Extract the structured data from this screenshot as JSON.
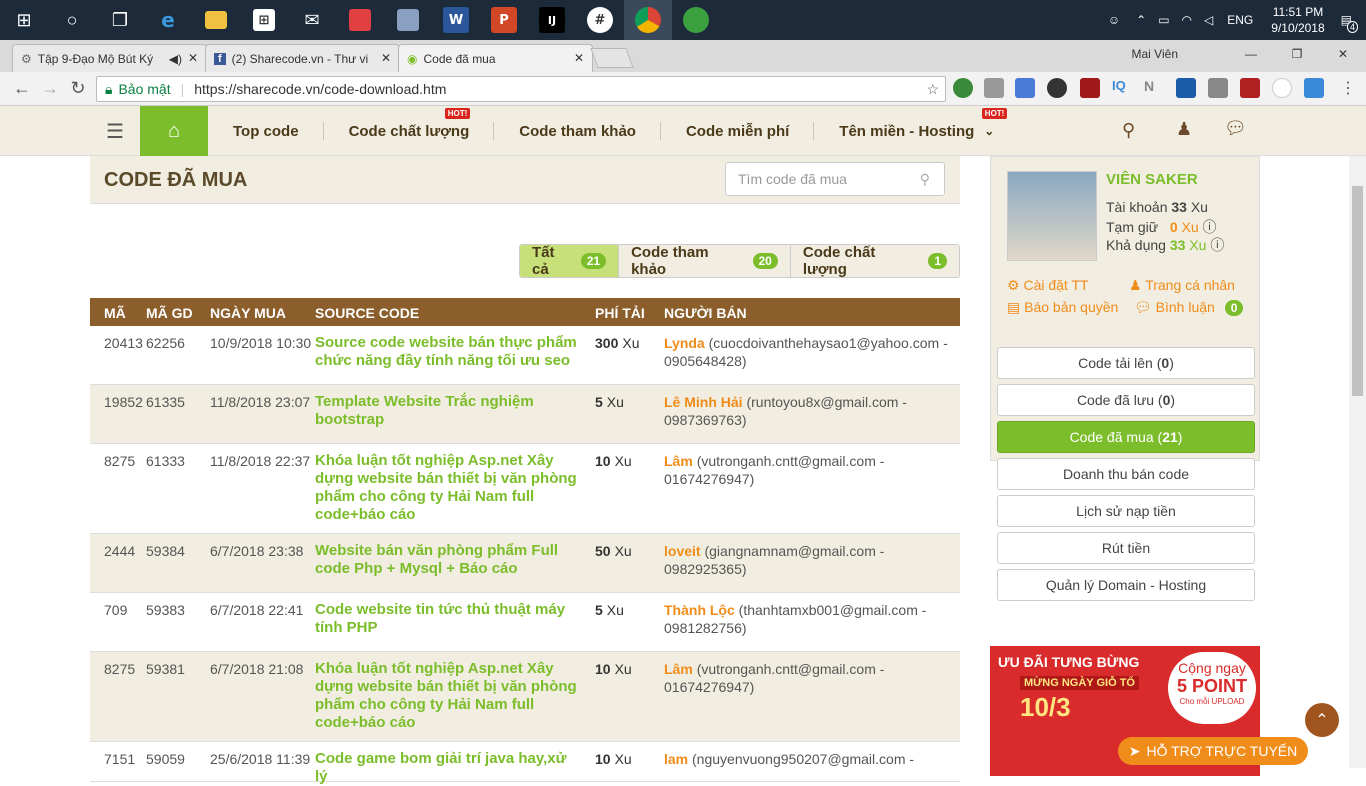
{
  "taskbar": {
    "time": "11:51 PM",
    "date": "9/10/2018",
    "lang": "ENG",
    "notif_count": "4"
  },
  "tabs": [
    {
      "label": "Tập 9-Đạo Mộ Bút Ký"
    },
    {
      "label": "(2) Sharecode.vn - Thư vi"
    },
    {
      "label": "Code đã mua"
    }
  ],
  "window": {
    "user": "Mai Viên"
  },
  "address": {
    "secure_label": "Bảo mật",
    "url": "https://sharecode.vn/code-download.htm"
  },
  "nav": {
    "items": [
      "Top code",
      "Code chất lượng",
      "Code tham khảo",
      "Code miễn phí",
      "Tên miền - Hosting"
    ],
    "hot": "HOT!"
  },
  "page": {
    "title": "CODE ĐÃ MUA",
    "search_placeholder": "Tìm code đã mua"
  },
  "filters": [
    {
      "label": "Tất cả",
      "count": "21"
    },
    {
      "label": "Code tham khảo",
      "count": "20"
    },
    {
      "label": "Code chất lượng",
      "count": "1"
    }
  ],
  "table": {
    "headers": [
      "MÃ",
      "MÃ GD",
      "NGÀY MUA",
      "SOURCE CODE",
      "PHÍ TẢI",
      "NGƯỜI BÁN"
    ],
    "unit": "Xu",
    "rows": [
      {
        "ma": "20413",
        "gd": "62256",
        "date": "10/9/2018 10:30",
        "src": "Source code website bán thực phẩm chức năng đầy tính năng tối ưu seo",
        "fee": "300",
        "seller": "Lynda",
        "contact": "(cuocdoivanthehaysao1@yahoo.com - 0905648428)"
      },
      {
        "ma": "19852",
        "gd": "61335",
        "date": "11/8/2018 23:07",
        "src": "Template Website Trắc nghiệm bootstrap",
        "fee": "5",
        "seller": "Lê Minh Hải",
        "contact": "(runtoyou8x@gmail.com - 0987369763)"
      },
      {
        "ma": "8275",
        "gd": "61333",
        "date": "11/8/2018 22:37",
        "src": "Khóa luận tốt nghiệp Asp.net Xây dựng website bán thiết bị văn phòng phẩm cho công ty Hải Nam full code+báo cáo",
        "fee": "10",
        "seller": "Lâm",
        "contact": "(vutronganh.cntt@gmail.com - 01674276947)"
      },
      {
        "ma": "2444",
        "gd": "59384",
        "date": "6/7/2018 23:38",
        "src": "Website bán văn phòng phẩm Full code Php + Mysql + Báo cáo",
        "fee": "50",
        "seller": "loveit",
        "contact": "(giangnamnam@gmail.com - 0982925365)"
      },
      {
        "ma": "709",
        "gd": "59383",
        "date": "6/7/2018 22:41",
        "src": "Code website tin tức thủ thuật máy tính PHP",
        "fee": "5",
        "seller": "Thành Lộc",
        "contact": "(thanhtamxb001@gmail.com - 0981282756)"
      },
      {
        "ma": "8275",
        "gd": "59381",
        "date": "6/7/2018 21:08",
        "src": "Khóa luận tốt nghiệp Asp.net Xây dựng website bán thiết bị văn phòng phẩm cho công ty Hải Nam full code+báo cáo",
        "fee": "10",
        "seller": "Lâm",
        "contact": "(vutronganh.cntt@gmail.com - 01674276947)"
      },
      {
        "ma": "7151",
        "gd": "59059",
        "date": "25/6/2018 11:39",
        "src": "Code game bom giải trí java hay,xử lý",
        "fee": "10",
        "seller": "lam",
        "contact": "(nguyenvuong950207@gmail.com -"
      }
    ]
  },
  "profile": {
    "name": "VIÊN SAKER",
    "account_label": "Tài khoản",
    "account_value": "33",
    "account_unit": "Xu",
    "hold_label": "Tạm giữ",
    "hold_value": "0",
    "hold_unit": "Xu",
    "avail_label": "Khả dụng",
    "avail_value": "33",
    "avail_unit": "Xu",
    "links": [
      "Cài đặt TT",
      "Trang cá nhân",
      "Báo bản quyền",
      "Bình luận"
    ],
    "comments_count": "0"
  },
  "side_menu": [
    {
      "label": "Code tải lên",
      "count": "0"
    },
    {
      "label": "Code đã lưu",
      "count": "0"
    },
    {
      "label": "Code đã mua",
      "count": "21"
    },
    {
      "label": "Doanh thu bán code"
    },
    {
      "label": "Lịch sử nạp tiền"
    },
    {
      "label": "Rút tiền"
    },
    {
      "label": "Quản lý Domain - Hosting"
    }
  ],
  "promo": {
    "line1": "ƯU ĐÃI TƯNG BỪNG",
    "line2": "MỪNG NGÀY GIỖ TỔ",
    "date": "10/3",
    "cta1": "Cộng ngay",
    "cta2": "5 POINT",
    "cta3": "Cho mỗi UPLOAD"
  },
  "support": {
    "label": "HỖ TRỢ TRỰC TUYẾN"
  }
}
